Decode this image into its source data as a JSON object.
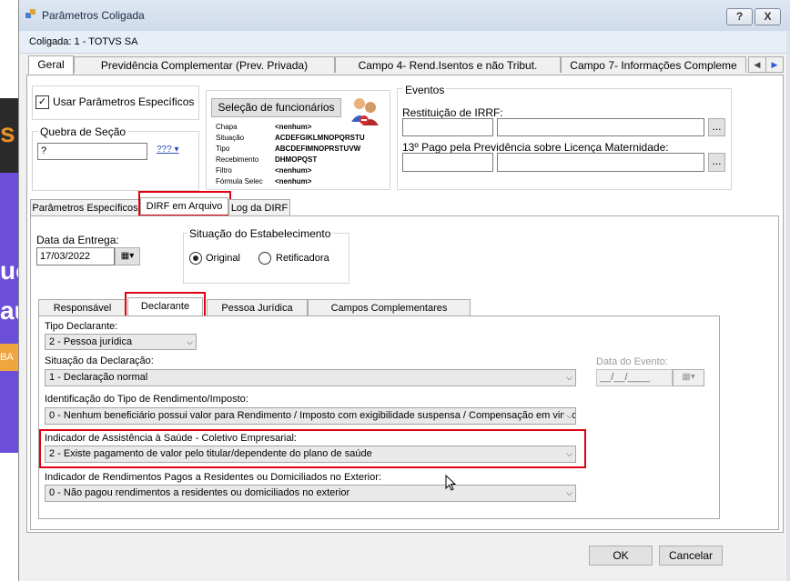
{
  "background": {
    "orange_text": "s i",
    "white_text_1": "ue",
    "white_text_2": "au",
    "button_text": "BA"
  },
  "window": {
    "title": "Parâmetros Coligada",
    "help_button": "?",
    "close_button": "X",
    "coligada": "Coligada: 1 - TOTVS SA"
  },
  "main_tabs": [
    {
      "label": "Geral"
    },
    {
      "label": "Previdência Complementar (Prev. Privada)"
    },
    {
      "label": "Campo 4- Rend.Isentos e não Tribut."
    },
    {
      "label": "Campo 7- Informações Compleme"
    }
  ],
  "geral": {
    "usar_parametros": "Usar Parâmetros Específicos",
    "quebra_label": "Quebra de Seção",
    "quebra_value": "?",
    "quebra_btn": "???",
    "selecao_btn": "Seleção de funcionários",
    "filters": [
      {
        "label": "Chapa",
        "value": "<nenhum>"
      },
      {
        "label": "Situação",
        "value": "ACDEFGIKLMNOPQRSTU"
      },
      {
        "label": "Tipo",
        "value": "ABCDEFIMNOPRSTUVW"
      },
      {
        "label": "Recebimento",
        "value": "DHMOPQST"
      },
      {
        "label": "Filtro",
        "value": "<nenhum>"
      },
      {
        "label": "Fórmula Selec",
        "value": "<nenhum>"
      }
    ],
    "eventos_title": "Eventos",
    "restituicao_label": "Restituição de IRRF:",
    "decimo_label": "13º Pago pela Previdência sobre Licença Maternidade:",
    "ellipsis": "..."
  },
  "sub_tabs": [
    {
      "label": "Parâmetros Específicos"
    },
    {
      "label": "DIRF em Arquivo"
    },
    {
      "label": "Log da DIRF"
    }
  ],
  "dirf": {
    "data_entrega_label": "Data da Entrega:",
    "data_entrega_value": "17/03/2022",
    "situacao_estab_title": "Situação do Estabelecimento",
    "original_label": "Original",
    "retificadora_label": "Retificadora",
    "selected": "Original"
  },
  "inner_tabs": [
    {
      "label": "Responsável"
    },
    {
      "label": "Declarante"
    },
    {
      "label": "Pessoa Jurídica"
    },
    {
      "label": "Campos Complementares"
    }
  ],
  "declarante": {
    "tipo_label": "Tipo Declarante:",
    "tipo_value": "2 - Pessoa jurídica",
    "situacao_label": "Situação da Declaração:",
    "situacao_value": "1 - Declaração normal",
    "data_evento_label": "Data do Evento:",
    "data_evento_value": "__/__/____",
    "identificacao_label": "Identificação do Tipo de Rendimento/Imposto:",
    "identificacao_value": "0 - Nenhum beneficiário possui valor para Rendimento / Imposto com exigibilidade suspensa / Compensação em virtuc",
    "assistencia_label": "Indicador de Assistência à Saúde - Coletivo Empresarial:",
    "assistencia_value": "2 - Existe pagamento de valor pelo titular/dependente do plano de saúde",
    "residentes_label": "Indicador de Rendimentos Pagos a Residentes ou Domiciliados no Exterior:",
    "residentes_value": "0 - Não pagou rendimentos a residentes ou domiciliados no exterior"
  },
  "footer": {
    "ok": "OK",
    "cancel": "Cancelar"
  },
  "colors": {
    "highlight": "#e00012",
    "titlebar": "#dfe7f2"
  }
}
